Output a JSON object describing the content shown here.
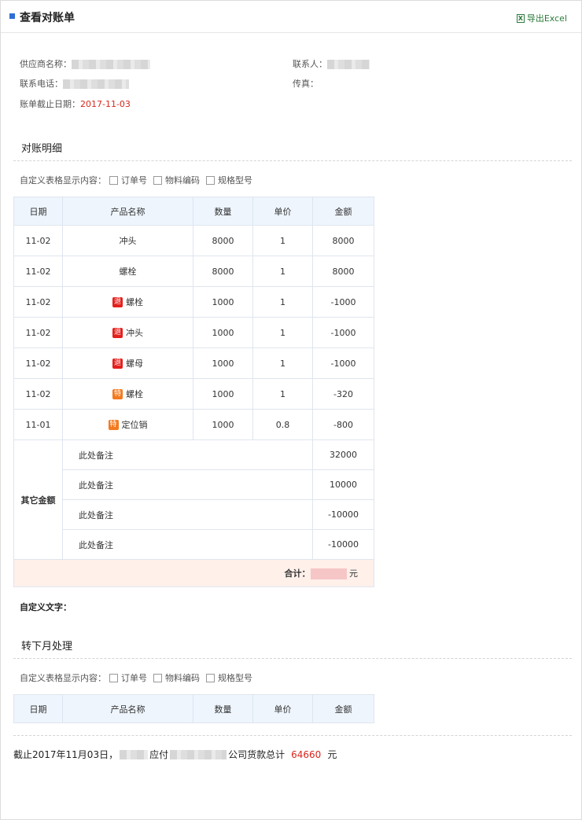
{
  "header": {
    "title": "查看对账单",
    "export_label": "导出Excel"
  },
  "info": {
    "supplier_label": "供应商名称：",
    "contact_label": "联系人：",
    "phone_label": "联系电话：",
    "fax_label": "传真：",
    "deadline_label": "账单截止日期：",
    "deadline_value": "2017-11-03"
  },
  "detail_section": {
    "title": "对账明细",
    "custom_label": "自定义表格显示内容：",
    "options": [
      "订单号",
      "物料编码",
      "规格型号"
    ],
    "columns": [
      "日期",
      "产品名称",
      "数量",
      "单价",
      "金额"
    ],
    "rows": [
      {
        "date": "11-02",
        "tag": "",
        "product": "冲头",
        "qty": "8000",
        "price": "1",
        "amount": "8000"
      },
      {
        "date": "11-02",
        "tag": "",
        "product": "螺栓",
        "qty": "8000",
        "price": "1",
        "amount": "8000"
      },
      {
        "date": "11-02",
        "tag": "退",
        "product": "螺栓",
        "qty": "1000",
        "price": "1",
        "amount": "-1000"
      },
      {
        "date": "11-02",
        "tag": "退",
        "product": "冲头",
        "qty": "1000",
        "price": "1",
        "amount": "-1000"
      },
      {
        "date": "11-02",
        "tag": "退",
        "product": "螺母",
        "qty": "1000",
        "price": "1",
        "amount": "-1000"
      },
      {
        "date": "11-02",
        "tag": "特",
        "product": "螺栓",
        "qty": "1000",
        "price": "1",
        "amount": "-320"
      },
      {
        "date": "11-01",
        "tag": "特",
        "product": "定位销",
        "qty": "1000",
        "price": "0.8",
        "amount": "-800"
      }
    ],
    "other_label": "其它金额",
    "other_rows": [
      {
        "note": "此处备注",
        "amount": "32000"
      },
      {
        "note": "此处备注",
        "amount": "10000"
      },
      {
        "note": "此处备注",
        "amount": "-10000"
      },
      {
        "note": "此处备注",
        "amount": "-10000"
      }
    ],
    "total_label": "合计：",
    "total_unit": "元"
  },
  "custom_text_label": "自定义文字：",
  "next_month_section": {
    "title": "转下月处理",
    "custom_label": "自定义表格显示内容：",
    "options": [
      "订单号",
      "物料编码",
      "规格型号"
    ],
    "columns": [
      "日期",
      "产品名称",
      "数量",
      "单价",
      "金额"
    ]
  },
  "summary": {
    "prefix": "截止2017年11月03日，",
    "pay_word": "应付",
    "company_word": "公司货款总计",
    "total": "64660",
    "unit": "元"
  },
  "colors": {
    "accent": "#2d6fd6",
    "red": "#d9261c",
    "return_tag": "#e4201d",
    "special_tag": "#f47a1f"
  }
}
